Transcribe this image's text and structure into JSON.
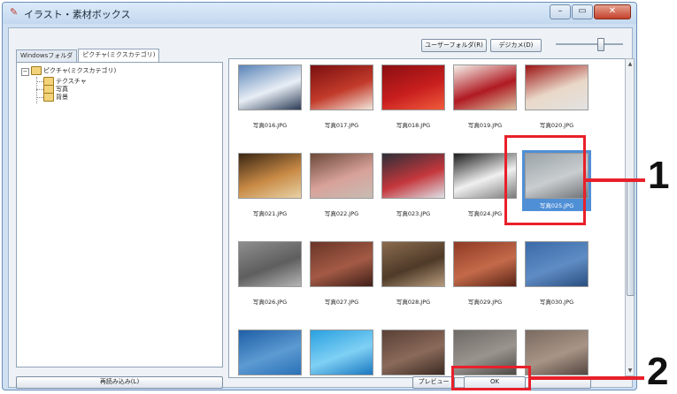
{
  "window": {
    "title": "イラスト・素材ボックス",
    "minimize_label": "▭",
    "maximize_label": "▭",
    "close_label": "✕"
  },
  "tabs": [
    {
      "label": "Windowsフォルダ",
      "active": false
    },
    {
      "label": "ピクチャ(ミクスカテゴリ)",
      "active": true
    }
  ],
  "toolbar": {
    "user_folder_label": "ユーザーフォルダ(R)",
    "digital_camera_label": "デジカメ(D)",
    "thumbnail_size_fraction": 0.66
  },
  "tree": {
    "root": "ピクチャ(ミクスカテゴリ)",
    "children": [
      "テクスチャ",
      "写真",
      "背景"
    ]
  },
  "thumbnails": [
    {
      "caption": "写真016.JPG",
      "colors": [
        "#5a84b8",
        "#e8eef5",
        "#2b3b55"
      ]
    },
    {
      "caption": "写真017.JPG",
      "colors": [
        "#7a1010",
        "#c23a2a",
        "#f2e7dc"
      ]
    },
    {
      "caption": "写真018.JPG",
      "colors": [
        "#8a0f12",
        "#c81e1e",
        "#f05c3c"
      ]
    },
    {
      "caption": "写真019.JPG",
      "colors": [
        "#f4f0ea",
        "#b01a22",
        "#d7c1a0"
      ]
    },
    {
      "caption": "写真020.JPG",
      "colors": [
        "#9c1313",
        "#e9d8c8",
        "#e2e2e2"
      ]
    },
    {
      "caption": "写真021.JPG",
      "colors": [
        "#3a2614",
        "#c88a45",
        "#e8d2a6"
      ]
    },
    {
      "caption": "写真022.JPG",
      "colors": [
        "#6d4a3a",
        "#d8a29a",
        "#c7bcb3"
      ]
    },
    {
      "caption": "写真023.JPG",
      "colors": [
        "#2d2f38",
        "#c4373c",
        "#dde2e8"
      ]
    },
    {
      "caption": "写真024.JPG",
      "colors": [
        "#1d1d1d",
        "#f0f0f0",
        "#7a7a7a"
      ]
    },
    {
      "caption": "写真025.JPG",
      "colors": [
        "#9aa3a8",
        "#c9cdcf",
        "#6e7276"
      ],
      "selected": true
    },
    {
      "caption": "写真026.JPG",
      "colors": [
        "#8e8e8e",
        "#5e5e5e",
        "#b4b4b4"
      ]
    },
    {
      "caption": "写真027.JPG",
      "colors": [
        "#6a3527",
        "#a35a45",
        "#3f1f18"
      ]
    },
    {
      "caption": "写真028.JPG",
      "colors": [
        "#8a6b4e",
        "#4e3a28",
        "#b79c7e"
      ]
    },
    {
      "caption": "写真029.JPG",
      "colors": [
        "#8f3a25",
        "#c46a4a",
        "#5a2416"
      ]
    },
    {
      "caption": "写真030.JPG",
      "colors": [
        "#3a6aa8",
        "#5f8cc4",
        "#2a4f80"
      ]
    },
    {
      "caption": "",
      "colors": [
        "#1f5fa6",
        "#5c9ad2",
        "#2a72b8"
      ]
    },
    {
      "caption": "",
      "colors": [
        "#2aa0e0",
        "#7fd0f4",
        "#1a78c0"
      ]
    },
    {
      "caption": "",
      "colors": [
        "#5a4036",
        "#8a6a5a",
        "#3b2a22"
      ]
    },
    {
      "caption": "",
      "colors": [
        "#6e6a66",
        "#9a948e",
        "#4d4a46"
      ]
    },
    {
      "caption": "",
      "colors": [
        "#7a6a60",
        "#a89486",
        "#544640"
      ]
    }
  ],
  "buttons": {
    "refresh_label": "再読み込み(L)",
    "preview_label": "プレビュー",
    "ok_label": "OK",
    "cancel_label": ""
  },
  "annotations": {
    "marker_1": "1",
    "marker_2": "2",
    "accent_color": "#e8202a"
  }
}
